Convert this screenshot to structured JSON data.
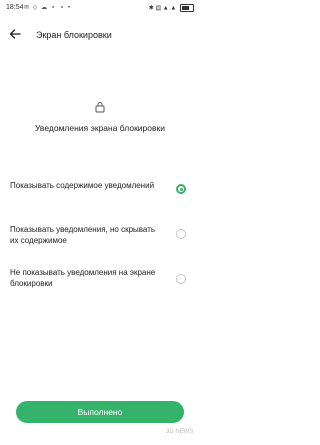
{
  "status_bar": {
    "time": "18:54",
    "left_icons": "✉ ◇ ☁ ⚬ ⚬ •",
    "right_icons": "✱ ▤ ▲ ▲"
  },
  "header": {
    "title": "Экран блокировки"
  },
  "section": {
    "description": "Уведомления экрана блокировки"
  },
  "options": [
    {
      "label": "Показывать содержимое уведомлений",
      "selected": true
    },
    {
      "label": "Показывать уведомления, но скрывать их содержимое",
      "selected": false
    },
    {
      "label": "Не показывать уведомления на экране блокировки",
      "selected": false
    }
  ],
  "footer": {
    "done_label": "Выполнено"
  },
  "colors": {
    "accent": "#35b36a"
  },
  "watermark": "3D NEWS"
}
